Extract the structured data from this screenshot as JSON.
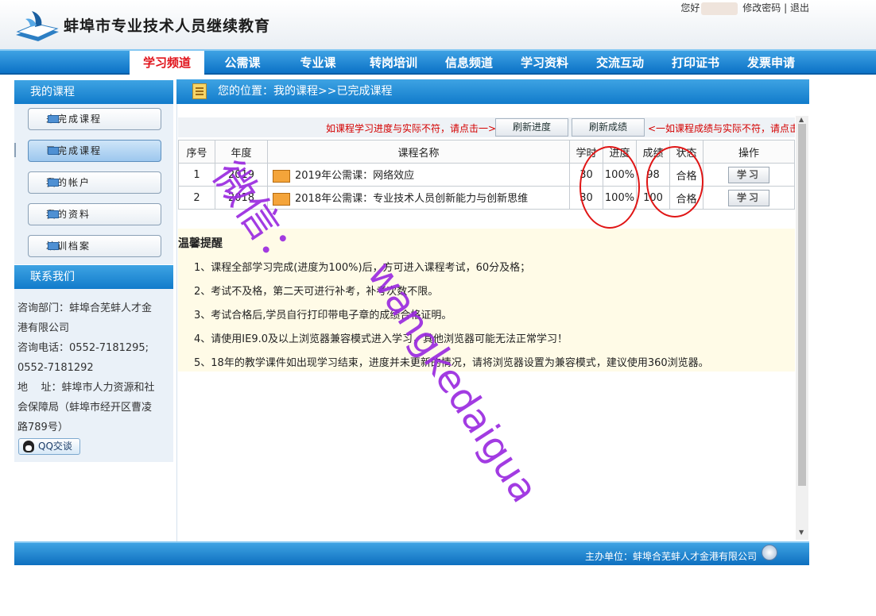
{
  "header": {
    "site_title": "蚌埠市专业技术人员继续教育",
    "greeting": "您好",
    "change_password": "修改密码",
    "separator": "|",
    "logout": "退出"
  },
  "nav": {
    "items": [
      "学习频道",
      "公需课",
      "专业课",
      "转岗培训",
      "信息频道",
      "学习资料",
      "交流互动",
      "打印证书",
      "发票申请"
    ],
    "active_index": 0
  },
  "sidebar": {
    "my_courses_title": "我的课程",
    "buttons": [
      "未完成课程",
      "已完成课程",
      "我的帐户",
      "我的资料",
      "培训档案"
    ],
    "active_index": 1,
    "contact_title": "联系我们",
    "contact_lines": [
      "咨询部门：蚌埠合芜蚌人才金",
      "港有限公司",
      "咨询电话：0552-7181295;",
      "0552-7181292",
      "地    址：蚌埠市人力资源和社",
      "会保障局（蚌埠市经开区曹凌",
      "路789号）"
    ],
    "qq_label": "QQ交谈"
  },
  "main": {
    "breadcrumb": "您的位置：我的课程>>已完成课程",
    "hint_left": "如课程学习进度与实际不符，请点击一>",
    "refresh_progress": "刷新进度",
    "refresh_score": "刷新成绩",
    "hint_right": "<一如课程成绩与实际不符，请点击",
    "table": {
      "headers": [
        "序号",
        "年度",
        "课程名称",
        "学时",
        "进度",
        "成绩",
        "状态",
        "操作"
      ],
      "rows": [
        {
          "index": "1",
          "year": "2019",
          "name": "2019年公需课：网络效应",
          "hours": "30",
          "progress": "100%",
          "score": "98",
          "status": "合格",
          "action": "学习"
        },
        {
          "index": "2",
          "year": "2018",
          "name": "2018年公需课：专业技术人员创新能力与创新思维",
          "hours": "30",
          "progress": "100%",
          "score": "100",
          "status": "合格",
          "action": "学习"
        }
      ]
    },
    "tips_title": "温馨提醒",
    "tips": [
      "1、课程全部学习完成(进度为100%)后，方可进入课程考试，60分及格；",
      "2、考试不及格，第二天可进行补考，补考次数不限。",
      "3、考试合格后,学员自行打印带电子章的成绩合格证明。",
      "4、请使用IE9.0及以上浏览器兼容模式进入学习，其他浏览器可能无法正常学习！",
      "5、18年的教学课件如出现学习结束，进度并未更新的情况，请将浏览器设置为兼容模式，建议使用360浏览器。"
    ]
  },
  "footer": {
    "sponsor": "主办单位：蚌埠合芜蚌人才金港有限公司"
  },
  "watermark": {
    "line1": "微信：",
    "line2": "wangkedaigua"
  },
  "colors": {
    "nav_blue": "#1a86d6",
    "active_red": "#e0121a",
    "pass_green": "#109020",
    "hint_red": "#d40000",
    "watermark_purple": "#9b2be0"
  }
}
